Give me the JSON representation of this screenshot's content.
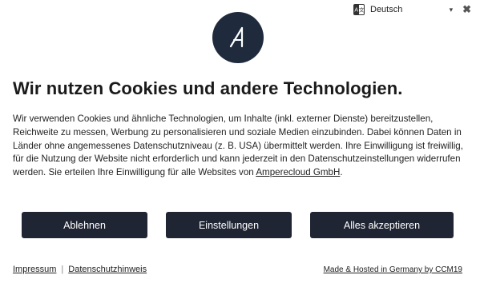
{
  "language": {
    "selected": "Deutsch",
    "icon": "language-icon",
    "caret": "▾",
    "close": "✖"
  },
  "logo": {
    "icon": "brand-logo-a"
  },
  "headline": "Wir nutzen Cookies und andere Technologien.",
  "body": {
    "text": "Wir verwenden Cookies und ähnliche Technologien, um Inhalte (inkl. externer Dienste) bereitzustellen, Reichweite zu messen, Werbung zu personalisieren und soziale Medien einzubinden. Dabei können Daten in Länder ohne angemessenes Datenschutzniveau (z. B. USA) übermittelt werden. Ihre Einwilligung ist freiwillig, für die Nutzung der Website nicht erforderlich und kann jederzeit in den Datenschutzeinstellungen widerrufen werden. Sie erteilen Ihre Einwilligung für alle Websites von ",
    "company_link": "Amperecloud GmbH",
    "end": "."
  },
  "buttons": {
    "reject": "Ablehnen",
    "settings": "Einstellungen",
    "accept": "Alles akzeptieren"
  },
  "footer": {
    "imprint": "Impressum",
    "separator": "|",
    "privacy": "Datenschutzhinweis",
    "hosted": "Made & Hosted in Germany by CCM19"
  },
  "colors": {
    "button_bg": "#1f2533",
    "logo_bg": "#1f2b3d"
  }
}
